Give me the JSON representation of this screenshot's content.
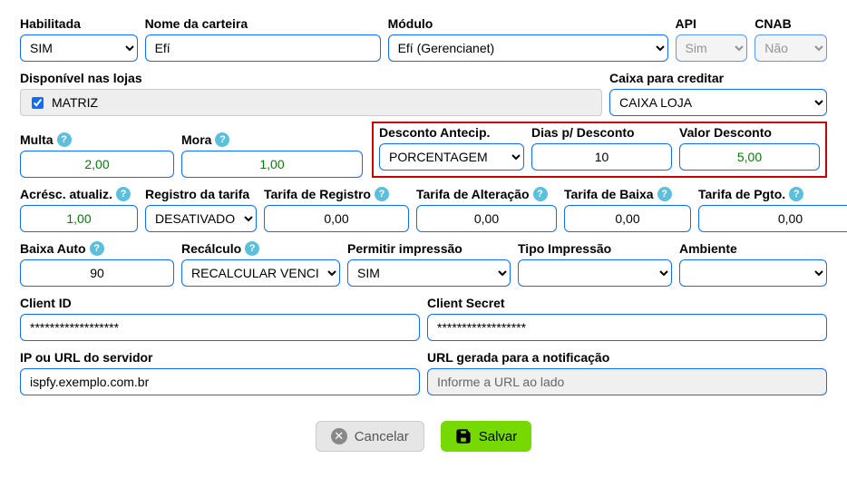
{
  "row1": {
    "habilitada": {
      "label": "Habilitada",
      "value": "SIM"
    },
    "nome_carteira": {
      "label": "Nome da carteira",
      "value": "Efí"
    },
    "modulo": {
      "label": "Módulo",
      "value": "Efí (Gerencianet)"
    },
    "api": {
      "label": "API",
      "value": "Sim"
    },
    "cnab": {
      "label": "CNAB",
      "value": "Não"
    }
  },
  "row2": {
    "disponivel_lojas": {
      "label": "Disponível nas lojas",
      "item": "MATRIZ"
    },
    "caixa_creditar": {
      "label": "Caixa para creditar",
      "value": "CAIXA LOJA"
    }
  },
  "row3": {
    "multa": {
      "label": "Multa",
      "value": "2,00"
    },
    "mora": {
      "label": "Mora",
      "value": "1,00"
    },
    "desconto_antecip": {
      "label": "Desconto Antecip.",
      "value": "PORCENTAGEM"
    },
    "dias_desconto": {
      "label": "Dias p/ Desconto",
      "value": "10"
    },
    "valor_desconto": {
      "label": "Valor Desconto",
      "value": "5,00"
    }
  },
  "row4": {
    "acresc_atualiz": {
      "label": "Acrésc. atualiz.",
      "value": "1,00"
    },
    "registro_tarifa": {
      "label": "Registro da tarifa",
      "value": "DESATIVADO"
    },
    "tarifa_registro": {
      "label": "Tarifa de Registro",
      "value": "0,00"
    },
    "tarifa_alteracao": {
      "label": "Tarifa de Alteração",
      "value": "0,00"
    },
    "tarifa_baixa": {
      "label": "Tarifa de Baixa",
      "value": "0,00"
    },
    "tarifa_pgto": {
      "label": "Tarifa de Pgto.",
      "value": "0,00"
    }
  },
  "row5": {
    "baixa_auto": {
      "label": "Baixa Auto",
      "value": "90"
    },
    "recalculo": {
      "label": "Recálculo",
      "value": "RECALCULAR VENCIMENTO"
    },
    "permitir_impressao": {
      "label": "Permitir impressão",
      "value": "SIM"
    },
    "tipo_impressao": {
      "label": "Tipo Impressão",
      "value": ""
    },
    "ambiente": {
      "label": "Ambiente",
      "value": ""
    }
  },
  "row6": {
    "client_id": {
      "label": "Client ID",
      "value": "******************"
    },
    "client_secret": {
      "label": "Client Secret",
      "value": "******************"
    }
  },
  "row7": {
    "ip_url": {
      "label": "IP ou URL do servidor",
      "value": "ispfy.exemplo.com.br"
    },
    "url_notificacao": {
      "label": "URL gerada para a notificação",
      "value": "Informe a URL ao lado"
    }
  },
  "buttons": {
    "cancel": "Cancelar",
    "save": "Salvar"
  },
  "help_icon": "?"
}
